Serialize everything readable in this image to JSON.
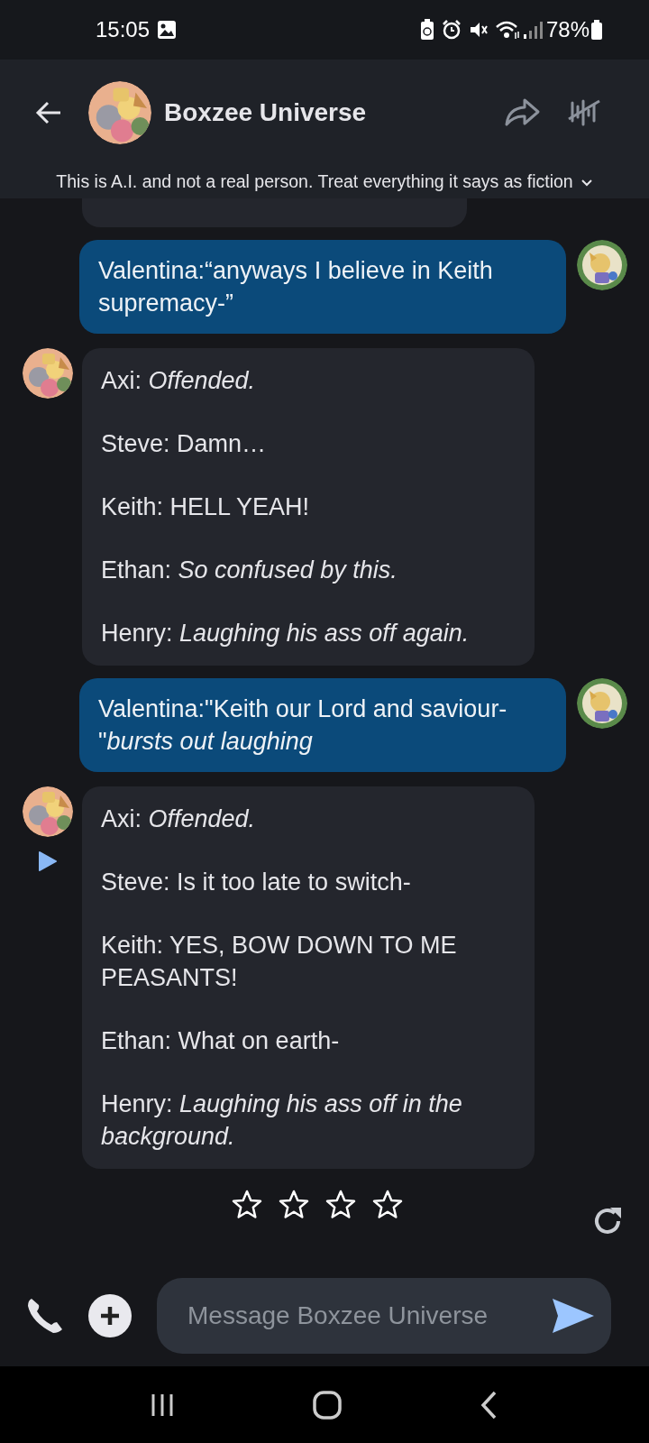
{
  "status_bar": {
    "time": "15:05",
    "battery": "78%"
  },
  "header": {
    "title": "Boxzee Universe"
  },
  "disclaimer": {
    "text": "This is A.I. and not a real person. Treat everything it says as fiction",
    "expanded": false
  },
  "messages": [
    {
      "kind": "partial"
    },
    {
      "kind": "user",
      "lines": [
        "Valentina:“anyways I believe in Keith supremacy-”"
      ]
    },
    {
      "kind": "bot",
      "play_button": false,
      "lines": [
        "Axi: *Offended.*",
        "Steve: Damn…",
        "Keith: HELL YEAH!",
        "Ethan: *So confused by this.*",
        "Henry: *Laughing his ass off again.*"
      ]
    },
    {
      "kind": "user",
      "lines": [
        "Valentina:\"Keith our Lord and saviour-\"*bursts out laughing*"
      ]
    },
    {
      "kind": "bot",
      "play_button": true,
      "lines": [
        "Axi: *Offended.*",
        "Steve: Is it too late to switch-",
        "Keith: YES, BOW DOWN TO ME PEASANTS!",
        "Ethan: What on earth-",
        "Henry: *Laughing his ass off in the background.*"
      ]
    }
  ],
  "rating": {
    "stars": 0
  },
  "composer": {
    "placeholder": "Message Boxzee Universe"
  }
}
